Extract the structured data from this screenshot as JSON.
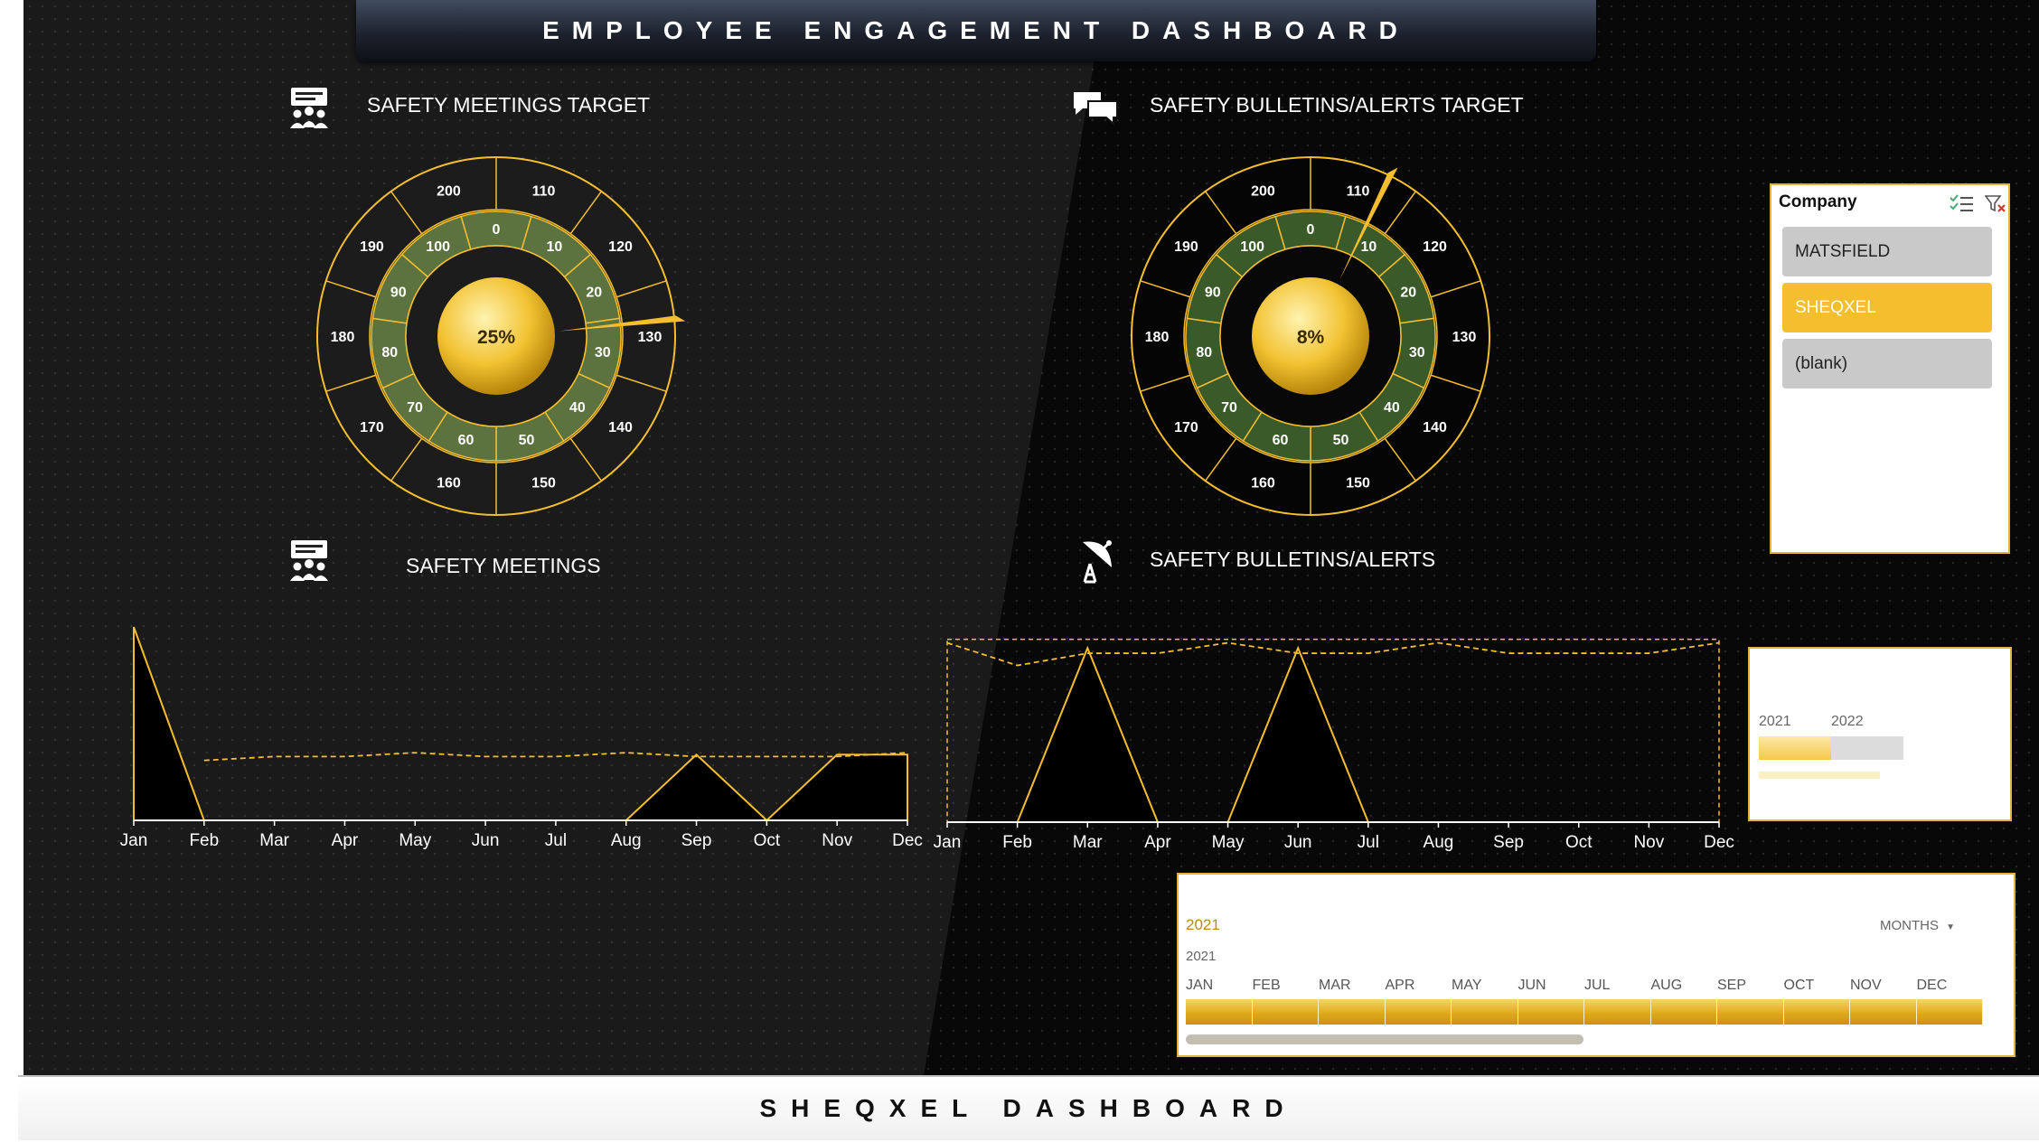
{
  "title": "EMPLOYEE ENGAGEMENT DASHBOARD",
  "footer": "SHEQXEL DASHBOARD",
  "colors": {
    "accent": "#f5be2f",
    "dial_green": "#5c7340",
    "dial_green_dark": "#3b5a2a",
    "background": "#080808"
  },
  "sections": {
    "meetings_target": {
      "title": "SAFETY MEETINGS TARGET",
      "icon": "meeting-presentation-icon"
    },
    "bulletins_target": {
      "title": "SAFETY BULLETINS/ALERTS TARGET",
      "icon": "chat-bubbles-icon"
    },
    "meetings": {
      "title": "SAFETY MEETINGS",
      "icon": "meeting-presentation-icon"
    },
    "bulletins": {
      "title": "SAFETY BULLETINS/ALERTS",
      "icon": "satellite-dish-icon"
    }
  },
  "gauges": [
    {
      "id": "meetings",
      "value_label": "25%",
      "percent": 25,
      "inner_labels": [
        "0",
        "10",
        "20",
        "30",
        "40",
        "50",
        "60",
        "70",
        "80",
        "90",
        "100"
      ],
      "outer_labels": [
        "110",
        "120",
        "130",
        "140",
        "150",
        "160",
        "170",
        "180",
        "190",
        "200"
      ]
    },
    {
      "id": "bulletins",
      "value_label": "8%",
      "percent": 8,
      "inner_labels": [
        "0",
        "10",
        "20",
        "30",
        "40",
        "50",
        "60",
        "70",
        "80",
        "90",
        "100"
      ],
      "outer_labels": [
        "110",
        "120",
        "130",
        "140",
        "150",
        "160",
        "170",
        "180",
        "190",
        "200"
      ]
    }
  ],
  "chart_data": [
    {
      "type": "line",
      "title": "SAFETY MEETINGS",
      "categories": [
        "Jan",
        "Feb",
        "Mar",
        "Apr",
        "May",
        "Jun",
        "Jul",
        "Aug",
        "Sep",
        "Oct",
        "Nov",
        "Dec"
      ],
      "series": [
        {
          "style": "area",
          "values": [
            1,
            0,
            0,
            0,
            0,
            0,
            0,
            0,
            0.34,
            0,
            0.34,
            0.34
          ]
        },
        {
          "style": "dashed",
          "values": [
            null,
            0.31,
            0.33,
            0.33,
            0.35,
            0.33,
            0.33,
            0.35,
            0.33,
            0.33,
            0.33,
            0.35
          ]
        }
      ],
      "ylim": [
        0,
        1
      ]
    },
    {
      "type": "line",
      "title": "SAFETY BULLETINS/ALERTS",
      "categories": [
        "Jan",
        "Feb",
        "Mar",
        "Apr",
        "May",
        "Jun",
        "Jul",
        "Aug",
        "Sep",
        "Oct",
        "Nov",
        "Dec"
      ],
      "series": [
        {
          "style": "area",
          "values": [
            0,
            0,
            1,
            0,
            0,
            1,
            0,
            0,
            0,
            0,
            0,
            0
          ]
        },
        {
          "style": "dashed",
          "values": [
            1.03,
            0.9,
            0.97,
            0.97,
            1.03,
            0.97,
            0.97,
            1.03,
            0.97,
            0.97,
            0.97,
            1.03
          ]
        }
      ],
      "ylim": [
        0,
        1.1
      ]
    }
  ],
  "company_slicer": {
    "title": "Company",
    "items": [
      {
        "label": "MATSFIELD",
        "selected": false
      },
      {
        "label": "SHEQXEL",
        "selected": true
      },
      {
        "label": "(blank)",
        "selected": false
      }
    ]
  },
  "year_panel": {
    "labels": [
      "2021",
      "2022"
    ]
  },
  "timeline": {
    "selection": "2021",
    "period_dropdown": "MONTHS",
    "year": "2021",
    "months": [
      "JAN",
      "FEB",
      "MAR",
      "APR",
      "MAY",
      "JUN",
      "JUL",
      "AUG",
      "SEP",
      "OCT",
      "NOV",
      "DEC"
    ]
  }
}
